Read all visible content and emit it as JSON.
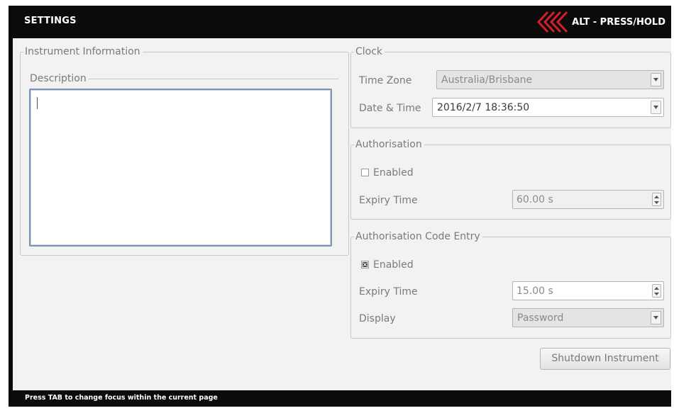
{
  "header": {
    "title": "SETTINGS",
    "alt_hint": "ALT - PRESS/HOLD",
    "alt_icon": "chevrons-left-icon",
    "accent_color": "#d41f26"
  },
  "instrument_information": {
    "legend": "Instrument Information",
    "description_label": "Description",
    "description_value": ""
  },
  "clock": {
    "legend": "Clock",
    "time_zone_label": "Time Zone",
    "time_zone_value": "Australia/Brisbane",
    "date_time_label": "Date & Time",
    "date_time_value": "2016/2/7 18:36:50"
  },
  "authorisation": {
    "legend": "Authorisation",
    "enabled_label": "Enabled",
    "enabled_checked": false,
    "expiry_label": "Expiry Time",
    "expiry_value": "60.00 s"
  },
  "authorisation_code_entry": {
    "legend": "Authorisation Code Entry",
    "enabled_label": "Enabled",
    "enabled_checked": true,
    "expiry_label": "Expiry Time",
    "expiry_value": "15.00 s",
    "display_label": "Display",
    "display_value": "Password"
  },
  "actions": {
    "shutdown_label": "Shutdown Instrument"
  },
  "status_bar": {
    "hint": "Press TAB to change focus within the current page"
  }
}
